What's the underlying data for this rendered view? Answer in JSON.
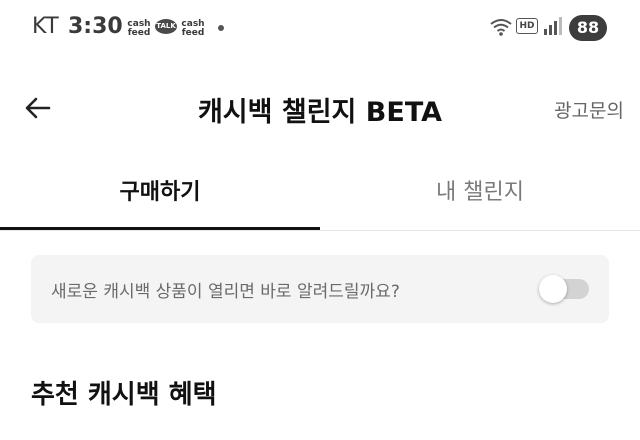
{
  "status_bar": {
    "carrier": "KT",
    "time": "3:30",
    "cashfeed_label": "cash feed",
    "talk_label": "TALK",
    "hd_label": "HD",
    "battery": "88"
  },
  "header": {
    "title": "캐시백 챌린지 BETA",
    "ad_inquiry": "광고문의",
    "back_icon": "arrow-left-icon"
  },
  "tabs": [
    {
      "label": "구매하기",
      "active": true
    },
    {
      "label": "내 챌린지",
      "active": false
    }
  ],
  "notify": {
    "text": "새로운 캐시백 상품이 열리면 바로 알려드릴까요?",
    "enabled": false
  },
  "section": {
    "title": "추천 캐시백 혜택"
  },
  "colors": {
    "text_primary": "#111111",
    "text_muted": "#7a7a7a",
    "card_bg": "#f4f4f4",
    "toggle_off": "#d3d3d3"
  }
}
